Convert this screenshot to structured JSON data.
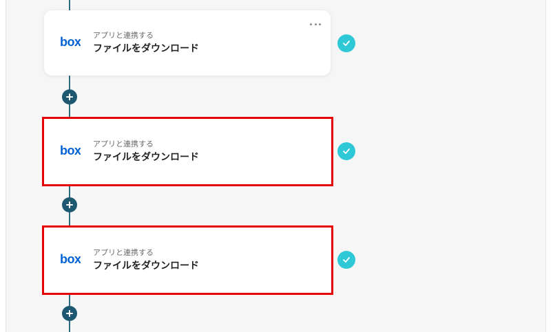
{
  "steps": [
    {
      "app_subtitle": "アプリと連携する",
      "action_title": "ファイルをダウンロード",
      "app_icon": "box-logo",
      "status_icon": "check-icon",
      "highlighted": false,
      "has_menu": true
    },
    {
      "app_subtitle": "アプリと連携する",
      "action_title": "ファイルをダウンロード",
      "app_icon": "box-logo",
      "status_icon": "check-icon",
      "highlighted": true,
      "has_menu": false
    },
    {
      "app_subtitle": "アプリと連携する",
      "action_title": "ファイルをダウンロード",
      "app_icon": "box-logo",
      "status_icon": "check-icon",
      "highlighted": true,
      "has_menu": false
    }
  ],
  "colors": {
    "flow_line": "#2d6b84",
    "add_button": "#1e5770",
    "check_badge": "#2ec8d6",
    "highlight_frame": "#e60000",
    "box_brand": "#0061d5"
  }
}
